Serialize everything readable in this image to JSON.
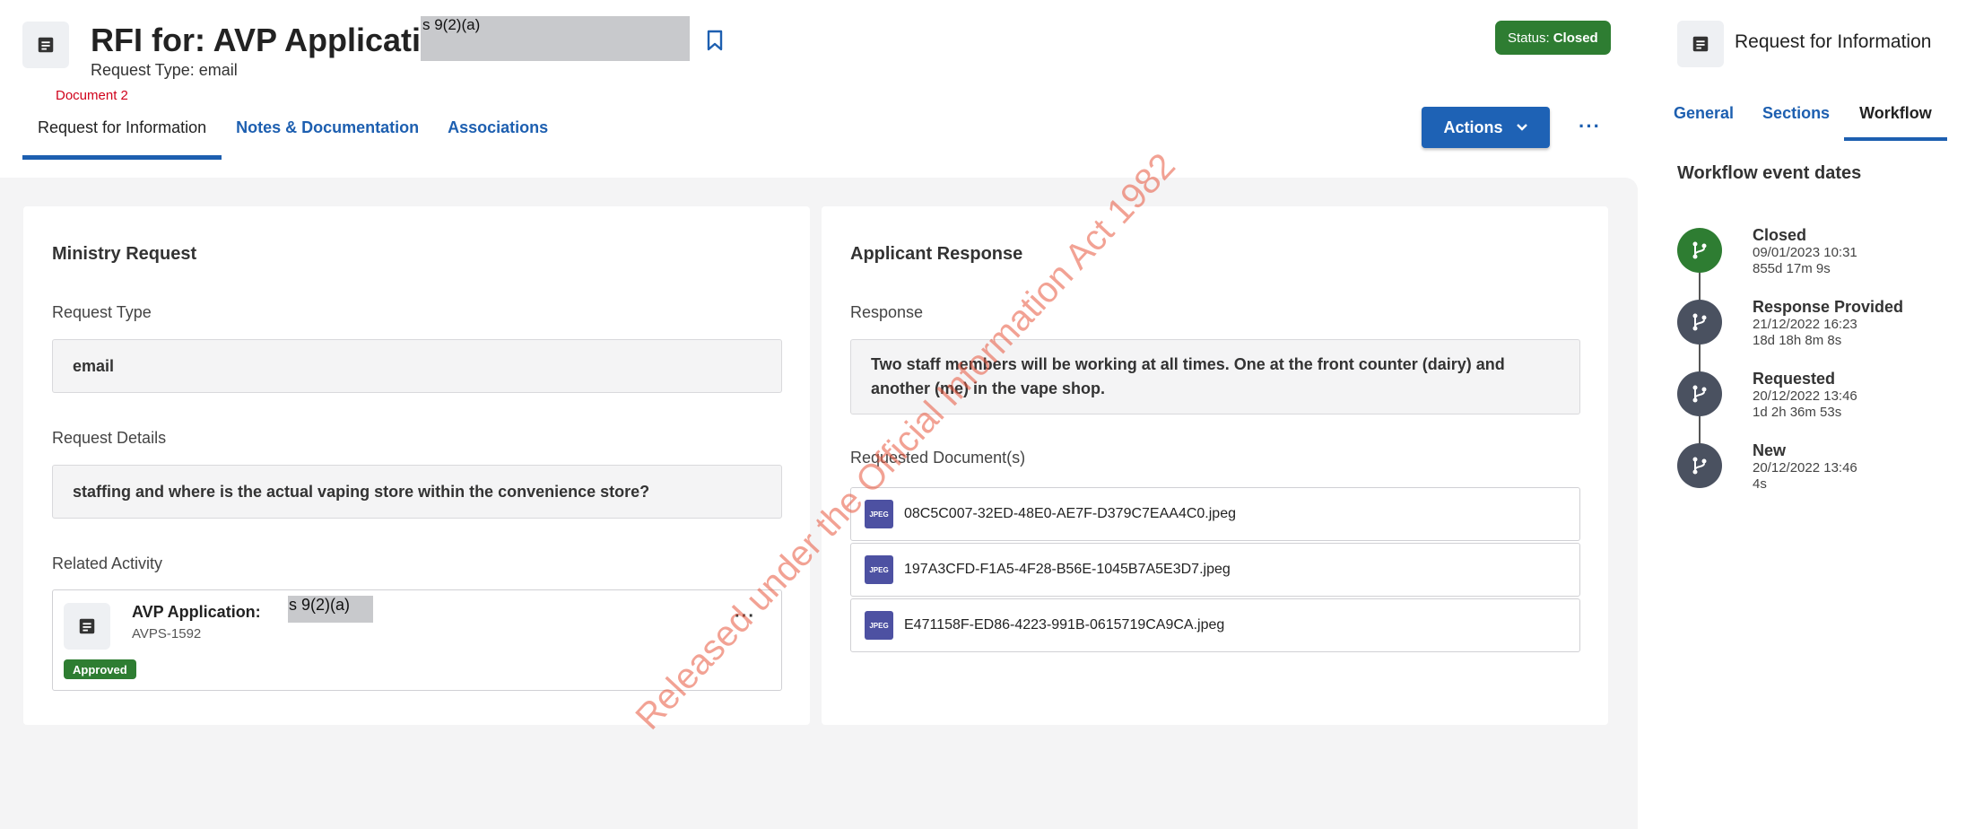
{
  "header": {
    "title": "RFI for: AVP Application:",
    "redaction_label": "s 9(2)(a)",
    "request_type": "Request Type: email",
    "document_label": "Document 2",
    "status_label": "Status:",
    "status_value": "Closed"
  },
  "tabs": [
    {
      "label": "Request for Information"
    },
    {
      "label": "Notes & Documentation"
    },
    {
      "label": "Associations"
    }
  ],
  "actions": {
    "label": "Actions",
    "more": "···"
  },
  "ministry": {
    "title": "Ministry Request",
    "request_type_label": "Request Type",
    "request_type_value": "email",
    "details_label": "Request Details",
    "details_value": "staffing and where is the actual vaping store within the convenience store?",
    "related_label": "Related Activity",
    "related": {
      "title": "AVP Application:",
      "redaction_label": "s 9(2)(a)",
      "code": "AVPS-1592",
      "badge": "Approved",
      "more": "···"
    }
  },
  "applicant": {
    "title": "Applicant Response",
    "response_label": "Response",
    "response_value": "Two staff members will be working at all times. One at the front counter (dairy) and another (me) in the vape shop.",
    "documents_label": "Requested Document(s)",
    "file_type": "JPEG",
    "documents": [
      {
        "name": "08C5C007-32ED-48E0-AE7F-D379C7EAA4C0.jpeg"
      },
      {
        "name": "197A3CFD-F1A5-4F28-B56E-1045B7A5E3D7.jpeg"
      },
      {
        "name": "E471158F-ED86-4223-991B-0615719CA9CA.jpeg"
      }
    ]
  },
  "sidebar": {
    "title": "Request for Information",
    "tabs": [
      {
        "label": "General"
      },
      {
        "label": "Sections"
      },
      {
        "label": "Workflow"
      }
    ],
    "workflow_heading": "Workflow event dates",
    "events": [
      {
        "name": "Closed",
        "date": "09/01/2023 10:31",
        "duration": "855d 17m 9s"
      },
      {
        "name": "Response Provided",
        "date": "21/12/2022 16:23",
        "duration": "18d 18h 8m 8s"
      },
      {
        "name": "Requested",
        "date": "20/12/2022 13:46",
        "duration": "1d 2h 36m 53s"
      },
      {
        "name": "New",
        "date": "20/12/2022 13:46",
        "duration": "4s"
      }
    ]
  },
  "watermark": "Released under the Official Information Act 1982",
  "colors": {
    "accent": "#1d5fb0",
    "status_green": "#2e7d32",
    "watermark": "#e8553c"
  }
}
